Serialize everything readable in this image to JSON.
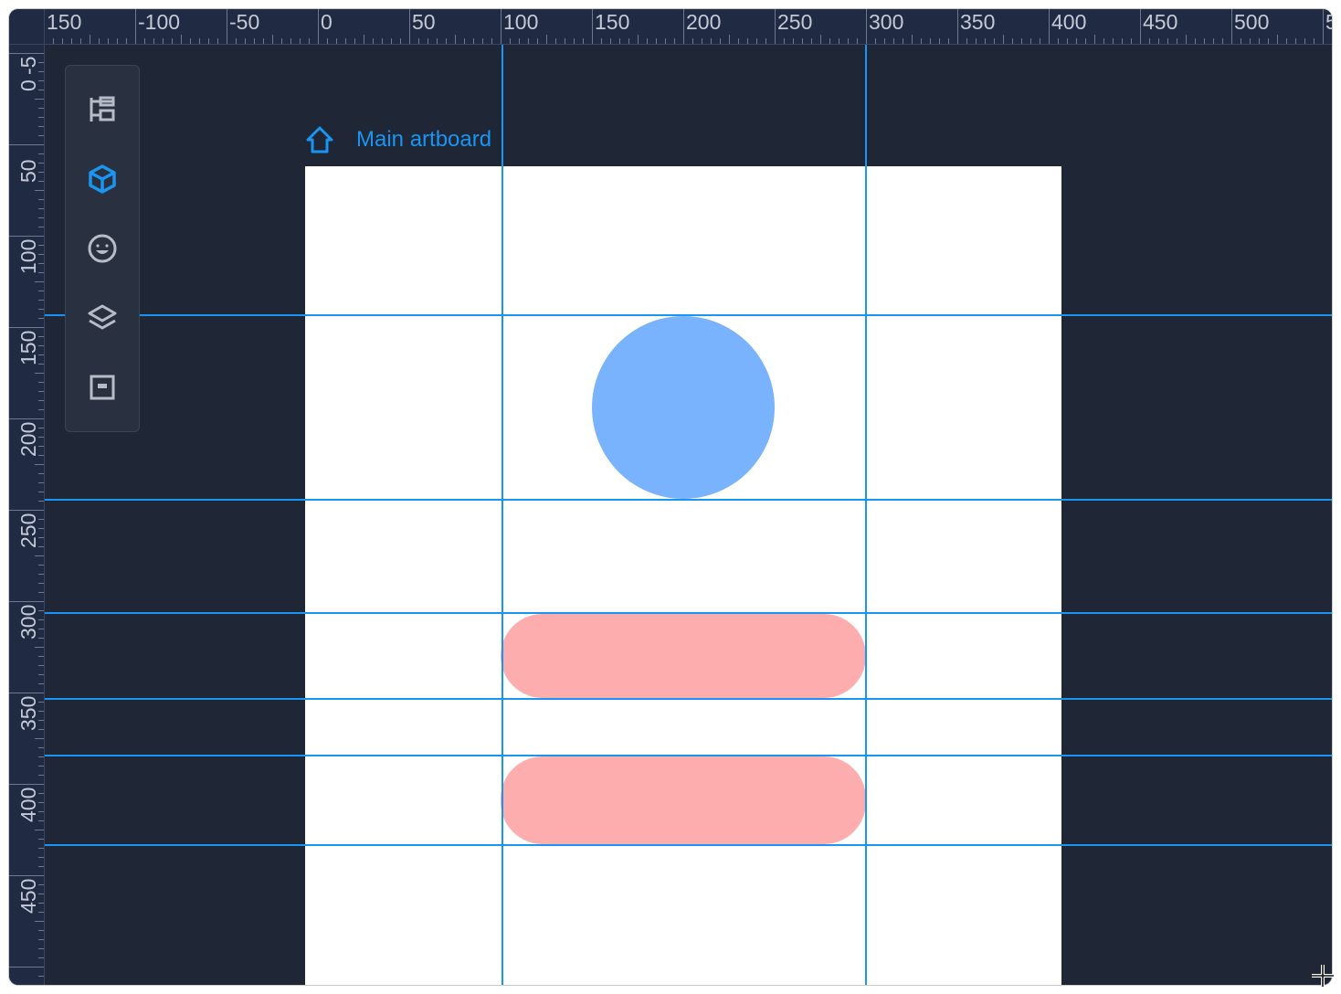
{
  "artboard": {
    "title": "Main artboard",
    "home_icon": "home-icon"
  },
  "toolbar": {
    "items": [
      {
        "name": "tree-icon",
        "active": false
      },
      {
        "name": "cube-icon",
        "active": true
      },
      {
        "name": "emoji-icon",
        "active": false
      },
      {
        "name": "layers-icon",
        "active": false
      },
      {
        "name": "frame-icon",
        "active": false
      }
    ]
  },
  "ruler_top": {
    "labels": [
      "150",
      "-100",
      "-50",
      "0",
      "50",
      "100",
      "150",
      "200",
      "250",
      "300",
      "350",
      "400",
      "450",
      "500",
      "5"
    ]
  },
  "ruler_left": {
    "labels": [
      "-5",
      "0",
      "50",
      "100",
      "150",
      "200",
      "250",
      "300",
      "350",
      "400",
      "450"
    ]
  },
  "shapes": [
    {
      "name": "circle",
      "color": "#7ab3fd"
    },
    {
      "name": "pill-1",
      "color": "#fdadad"
    },
    {
      "name": "pill-2",
      "color": "#fdadad"
    }
  ],
  "colors": {
    "canvas": "#1f2636",
    "ruler": "#202a42",
    "guide": "#1a95f2",
    "accent": "#1a95f2"
  }
}
